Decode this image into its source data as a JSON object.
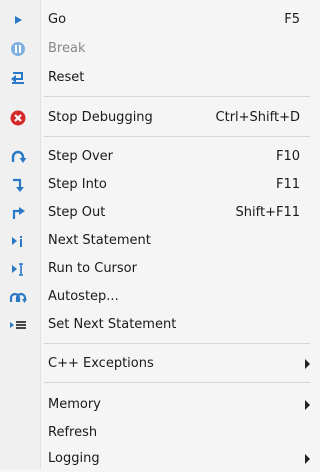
{
  "menu": {
    "items": [
      {
        "label": "Go",
        "shortcut": "F5",
        "icon": "play-icon"
      },
      {
        "label": "Break",
        "shortcut": "",
        "icon": "pause-icon",
        "disabled": true
      },
      {
        "label": "Reset",
        "shortcut": "",
        "icon": "reset-icon"
      },
      {
        "label": "Stop Debugging",
        "shortcut": "Ctrl+Shift+D",
        "icon": "stop-icon"
      },
      {
        "label": "Step Over",
        "shortcut": "F10",
        "icon": "step-over-icon"
      },
      {
        "label": "Step Into",
        "shortcut": "F11",
        "icon": "step-into-icon"
      },
      {
        "label": "Step Out",
        "shortcut": "Shift+F11",
        "icon": "step-out-icon"
      },
      {
        "label": "Next Statement",
        "shortcut": "",
        "icon": "next-statement-icon"
      },
      {
        "label": "Run to Cursor",
        "shortcut": "",
        "icon": "run-to-cursor-icon"
      },
      {
        "label": "Autostep...",
        "shortcut": "",
        "icon": "autostep-icon"
      },
      {
        "label": "Set Next Statement",
        "shortcut": "",
        "icon": "set-next-statement-icon"
      },
      {
        "label": "C++ Exceptions",
        "shortcut": "",
        "icon": "",
        "submenu": true
      },
      {
        "label": "Memory",
        "shortcut": "",
        "icon": "",
        "submenu": true
      },
      {
        "label": "Refresh",
        "shortcut": "",
        "icon": ""
      },
      {
        "label": "Logging",
        "shortcut": "",
        "icon": "",
        "submenu": true
      }
    ]
  },
  "colors": {
    "accent_blue": "#2b78c5",
    "stop_red": "#d42a2a",
    "disabled_text": "#888888"
  }
}
